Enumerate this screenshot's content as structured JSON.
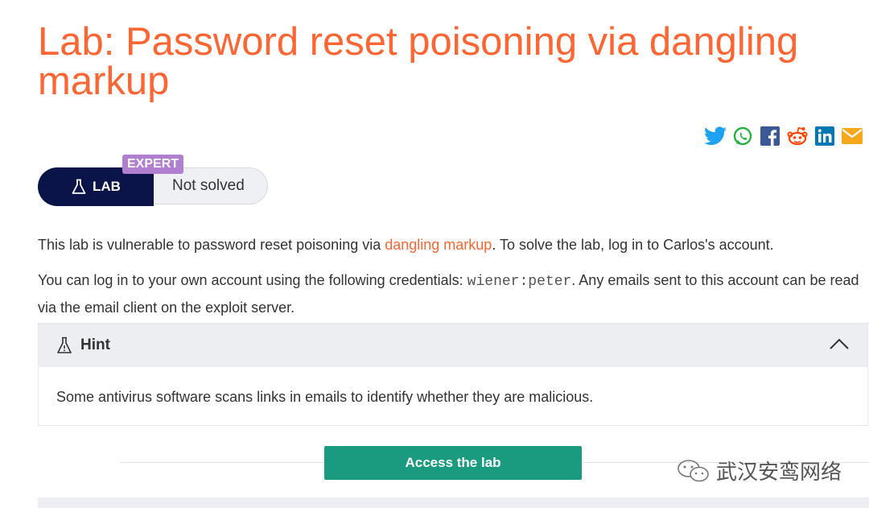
{
  "title": "Lab: Password reset poisoning via dangling markup",
  "share_icons": [
    "twitter-icon",
    "whatsapp-icon",
    "facebook-icon",
    "reddit-icon",
    "linkedin-icon",
    "email-icon"
  ],
  "badge": {
    "level": "EXPERT",
    "lab_label": "LAB",
    "status": "Not solved"
  },
  "description": {
    "p1_before": "This lab is vulnerable to password reset poisoning via ",
    "p1_link": "dangling markup",
    "p1_after": ". To solve the lab, log in to Carlos's account.",
    "p2_before": "You can log in to your own account using the following credentials: ",
    "p2_code": "wiener:peter",
    "p2_after": ". Any emails sent to this account can be read via the email client on the exploit server."
  },
  "hint": {
    "title": "Hint",
    "body": "Some antivirus software scans links in emails to identify whether they are malicious."
  },
  "access_button": "Access the lab",
  "watermark": "武汉安鸾网络",
  "colors": {
    "accent": "#ff6633",
    "lab_badge": "#0a1449",
    "expert_badge": "#b07fd0",
    "access_button": "#1a9b7f"
  }
}
